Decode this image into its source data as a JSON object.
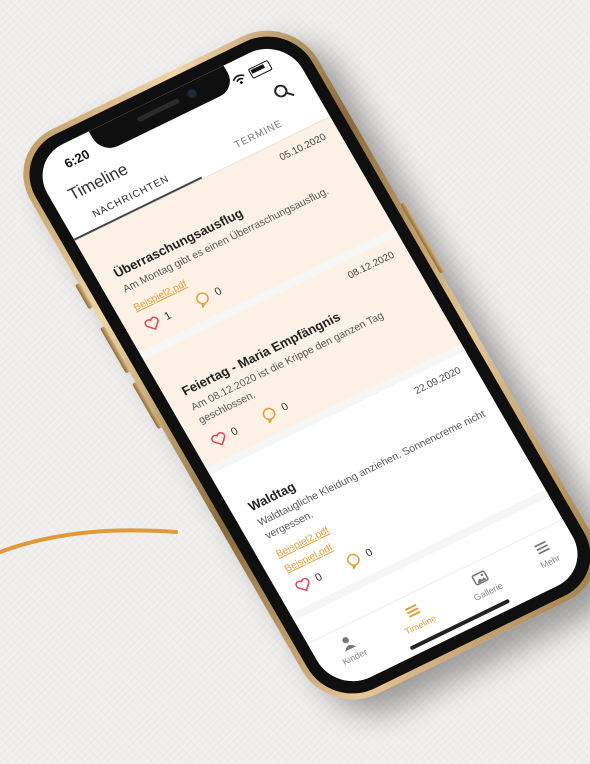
{
  "status": {
    "time": "6:20",
    "wifi_icon": "wifi-icon",
    "battery_icon": "battery-icon"
  },
  "appbar": {
    "title": "Timeline",
    "search_icon": "search-icon"
  },
  "tabs": [
    {
      "label": "NACHRICHTEN",
      "active": true
    },
    {
      "label": "TERMINE",
      "active": false
    }
  ],
  "posts": [
    {
      "date": "05.10.2020",
      "title": "Überraschungsausflug",
      "text": "Am Montag gibt es einen Überraschungsausflug.",
      "attachments": [
        "Beispiel2.pdf"
      ],
      "likes": "1",
      "comments": "0",
      "highlighted": true
    },
    {
      "date": "08.12.2020",
      "title": "Feiertag - Maria Empfängnis",
      "text": "Am 08.12.2020 ist die Krippe den ganzen Tag geschlossen.",
      "attachments": [],
      "likes": "0",
      "comments": "0",
      "highlighted": true
    },
    {
      "date": "22.09.2020",
      "title": "Waldtag",
      "text": "Waldtaugliche Kleidung anziehen. Sonnencreme nicht vergessen.",
      "attachments": [
        "Beispiel2.pdf",
        "Beispiel.pdf"
      ],
      "likes": "0",
      "comments": "0",
      "highlighted": false
    }
  ],
  "bottom_nav": [
    {
      "label": "Kinder",
      "icon": "person-icon",
      "active": false
    },
    {
      "label": "Timeline",
      "icon": "list-icon",
      "active": true
    },
    {
      "label": "Gallerie",
      "icon": "gallery-icon",
      "active": false
    },
    {
      "label": "Mehr",
      "icon": "menu-icon",
      "active": false
    }
  ],
  "colors": {
    "accent": "#e0a03a",
    "card_highlight": "#fdf1e6",
    "frame_gold": "#c9a46a",
    "deco_line": "#e09a3a"
  }
}
